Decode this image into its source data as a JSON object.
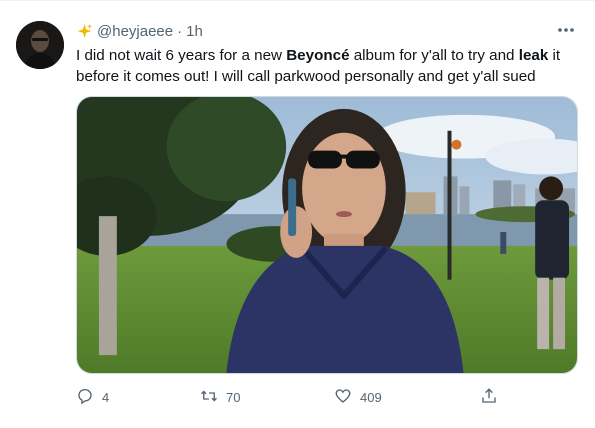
{
  "tweet": {
    "display_name_icon": "sparkles-icon",
    "handle": "@heyjaeee",
    "separator": "·",
    "time": "1h",
    "text": {
      "part1": "I did not wait 6 years for a new ",
      "bold1": "Beyoncé",
      "part2": " album for y'all to try and ",
      "bold2": "leak",
      "part3": " it before it comes out! I will call parkwood personally and get y'all sued"
    },
    "actions": {
      "reply_count": "4",
      "retweet_count": "70",
      "like_count": "409",
      "share_icon": "share-icon"
    }
  },
  "colors": {
    "text_primary": "#0f1419",
    "text_secondary": "#536471",
    "border": "#cfd9de"
  }
}
